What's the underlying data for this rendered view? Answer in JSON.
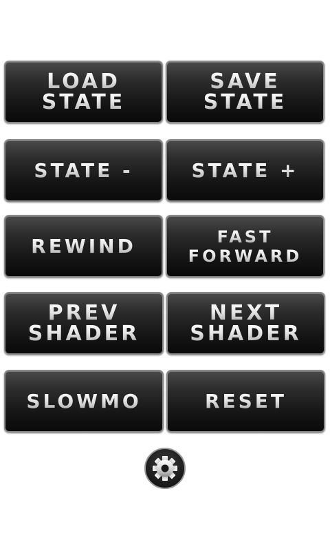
{
  "buttons": {
    "load_state": {
      "line1": "LOAD",
      "line2": "STATE"
    },
    "save_state": {
      "line1": "SAVE",
      "line2": "STATE"
    },
    "state_minus": {
      "line1": "STATE -"
    },
    "state_plus": {
      "line1": "STATE +"
    },
    "rewind": {
      "line1": "REWIND"
    },
    "fast_forward": {
      "line1": "FAST",
      "line2": "FORWARD"
    },
    "prev_shader": {
      "line1": "PREV",
      "line2": "SHADER"
    },
    "next_shader": {
      "line1": "NEXT",
      "line2": "SHADER"
    },
    "slowmo": {
      "line1": "SLOWMO"
    },
    "reset": {
      "line1": "RESET"
    }
  },
  "settings": {
    "icon": "gear-icon"
  }
}
